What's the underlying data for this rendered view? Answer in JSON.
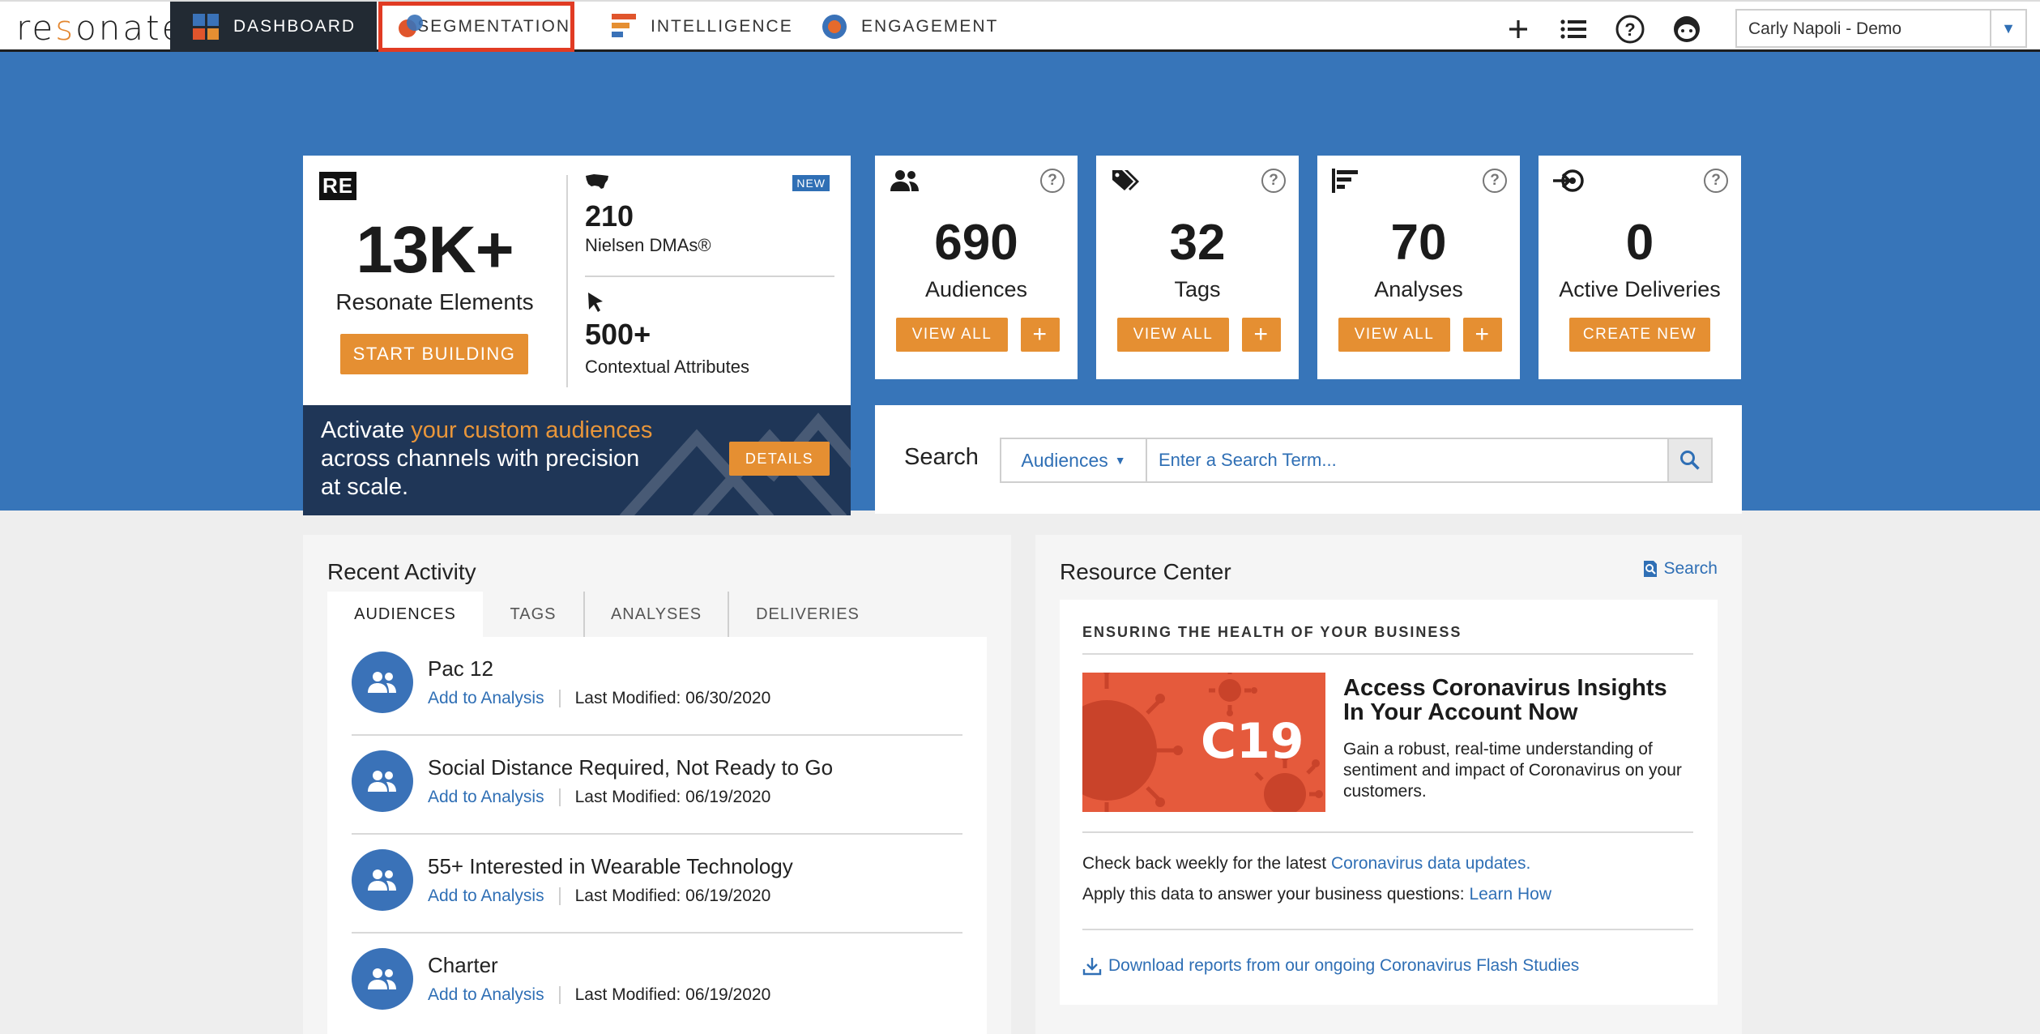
{
  "nav": {
    "logo": "resonate",
    "tabs": [
      {
        "label": "DASHBOARD"
      },
      {
        "label": "SEGMENTATION"
      },
      {
        "label": "INTELLIGENCE"
      },
      {
        "label": "ENGAGEMENT"
      }
    ],
    "user": "Carly Napoli - Demo"
  },
  "colors": {
    "hero_blue": "#3775b9",
    "accent_orange": "#e58f32",
    "link_blue": "#2f6fb5",
    "dark_nav": "#222a33",
    "highlight_red": "#e13b23"
  },
  "re_card": {
    "badge": "RE",
    "big_number": "13K+",
    "subtitle": "Resonate Elements",
    "button": "START BUILDING",
    "new_badge": "NEW",
    "stat1_num": "210",
    "stat1_label": "Nielsen DMAs®",
    "stat2_num": "500+",
    "stat2_label": "Contextual Attributes"
  },
  "promo": {
    "part1": "Activate ",
    "highlight": "your custom audiences",
    "part2": " across channels with precision at scale.",
    "button": "DETAILS"
  },
  "stats": [
    {
      "icon": "people-icon",
      "value": "690",
      "label": "Audiences",
      "button": "VIEW ALL",
      "plus": "+"
    },
    {
      "icon": "tags-icon",
      "value": "32",
      "label": "Tags",
      "button": "VIEW ALL",
      "plus": "+"
    },
    {
      "icon": "analysis-icon",
      "value": "70",
      "label": "Analyses",
      "button": "VIEW ALL",
      "plus": "+"
    },
    {
      "icon": "delivery-icon",
      "value": "0",
      "label": "Active Deliveries",
      "button": "CREATE NEW"
    }
  ],
  "search": {
    "label": "Search",
    "dropdown": "Audiences",
    "placeholder": "Enter a Search Term..."
  },
  "recent": {
    "title": "Recent Activity",
    "tabs": [
      "AUDIENCES",
      "TAGS",
      "ANALYSES",
      "DELIVERIES"
    ],
    "items": [
      {
        "name": "Pac 12",
        "action": "Add to Analysis",
        "modified": "Last Modified: 06/30/2020"
      },
      {
        "name": "Social Distance Required, Not Ready to Go",
        "action": "Add to Analysis",
        "modified": "Last Modified: 06/19/2020"
      },
      {
        "name": "55+ Interested in Wearable Technology",
        "action": "Add to Analysis",
        "modified": "Last Modified: 06/19/2020"
      },
      {
        "name": "Charter",
        "action": "Add to Analysis",
        "modified": "Last Modified: 06/19/2020"
      }
    ]
  },
  "resource": {
    "title": "Resource Center",
    "search": "Search",
    "heading": "ENSURING THE HEALTH OF YOUR BUSINESS",
    "image_text": "C19",
    "article_title": "Access Coronavirus Insights In Your Account Now",
    "article_desc": "Gain a robust, real-time understanding of sentiment and impact of Coronavirus on your customers.",
    "line1_text": "Check back weekly for the latest ",
    "line1_link": "Coronavirus data updates.",
    "line2_text": "Apply this data to answer your business questions: ",
    "line2_link": "Learn How",
    "download": "Download reports from our ongoing Coronavirus Flash Studies"
  }
}
